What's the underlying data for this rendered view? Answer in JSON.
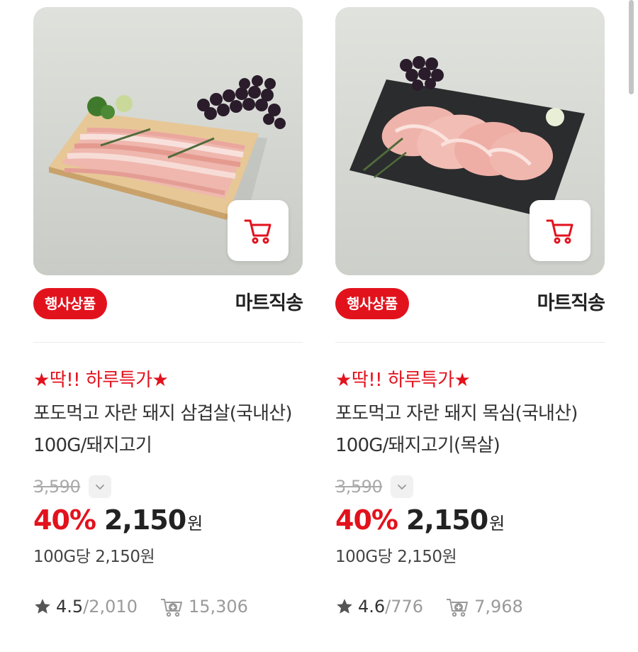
{
  "colors": {
    "accent": "#e2121d",
    "text": "#222222",
    "muted": "#9a9a9a"
  },
  "products": [
    {
      "image": "pork-belly-on-wooden-board-with-grapes",
      "event_badge": "행사상품",
      "delivery": "마트직송",
      "promo": "★딱!! 하루특가★",
      "name": "포도먹고 자란 돼지 삼겹살(국내산) 100G/돼지고기",
      "original_price": "3,590",
      "discount": "40%",
      "sale_price": "2,150",
      "currency": "원",
      "unit_price": "100G당 2,150원",
      "rating": "4.5",
      "reviews": "/2,010",
      "cart_count": "15,306",
      "icons": {
        "cart": "cart-icon",
        "chevron": "chevron-down-icon",
        "star": "star-icon",
        "bag": "cart-add-icon"
      }
    },
    {
      "image": "pork-neck-on-slate-with-grapes",
      "event_badge": "행사상품",
      "delivery": "마트직송",
      "promo": "★딱!! 하루특가★",
      "name": "포도먹고 자란 돼지 목심(국내산) 100G/돼지고기(목살)",
      "original_price": "3,590",
      "discount": "40%",
      "sale_price": "2,150",
      "currency": "원",
      "unit_price": "100G당 2,150원",
      "rating": "4.6",
      "reviews": "/776",
      "cart_count": "7,968",
      "icons": {
        "cart": "cart-icon",
        "chevron": "chevron-down-icon",
        "star": "star-icon",
        "bag": "cart-add-icon"
      }
    }
  ]
}
